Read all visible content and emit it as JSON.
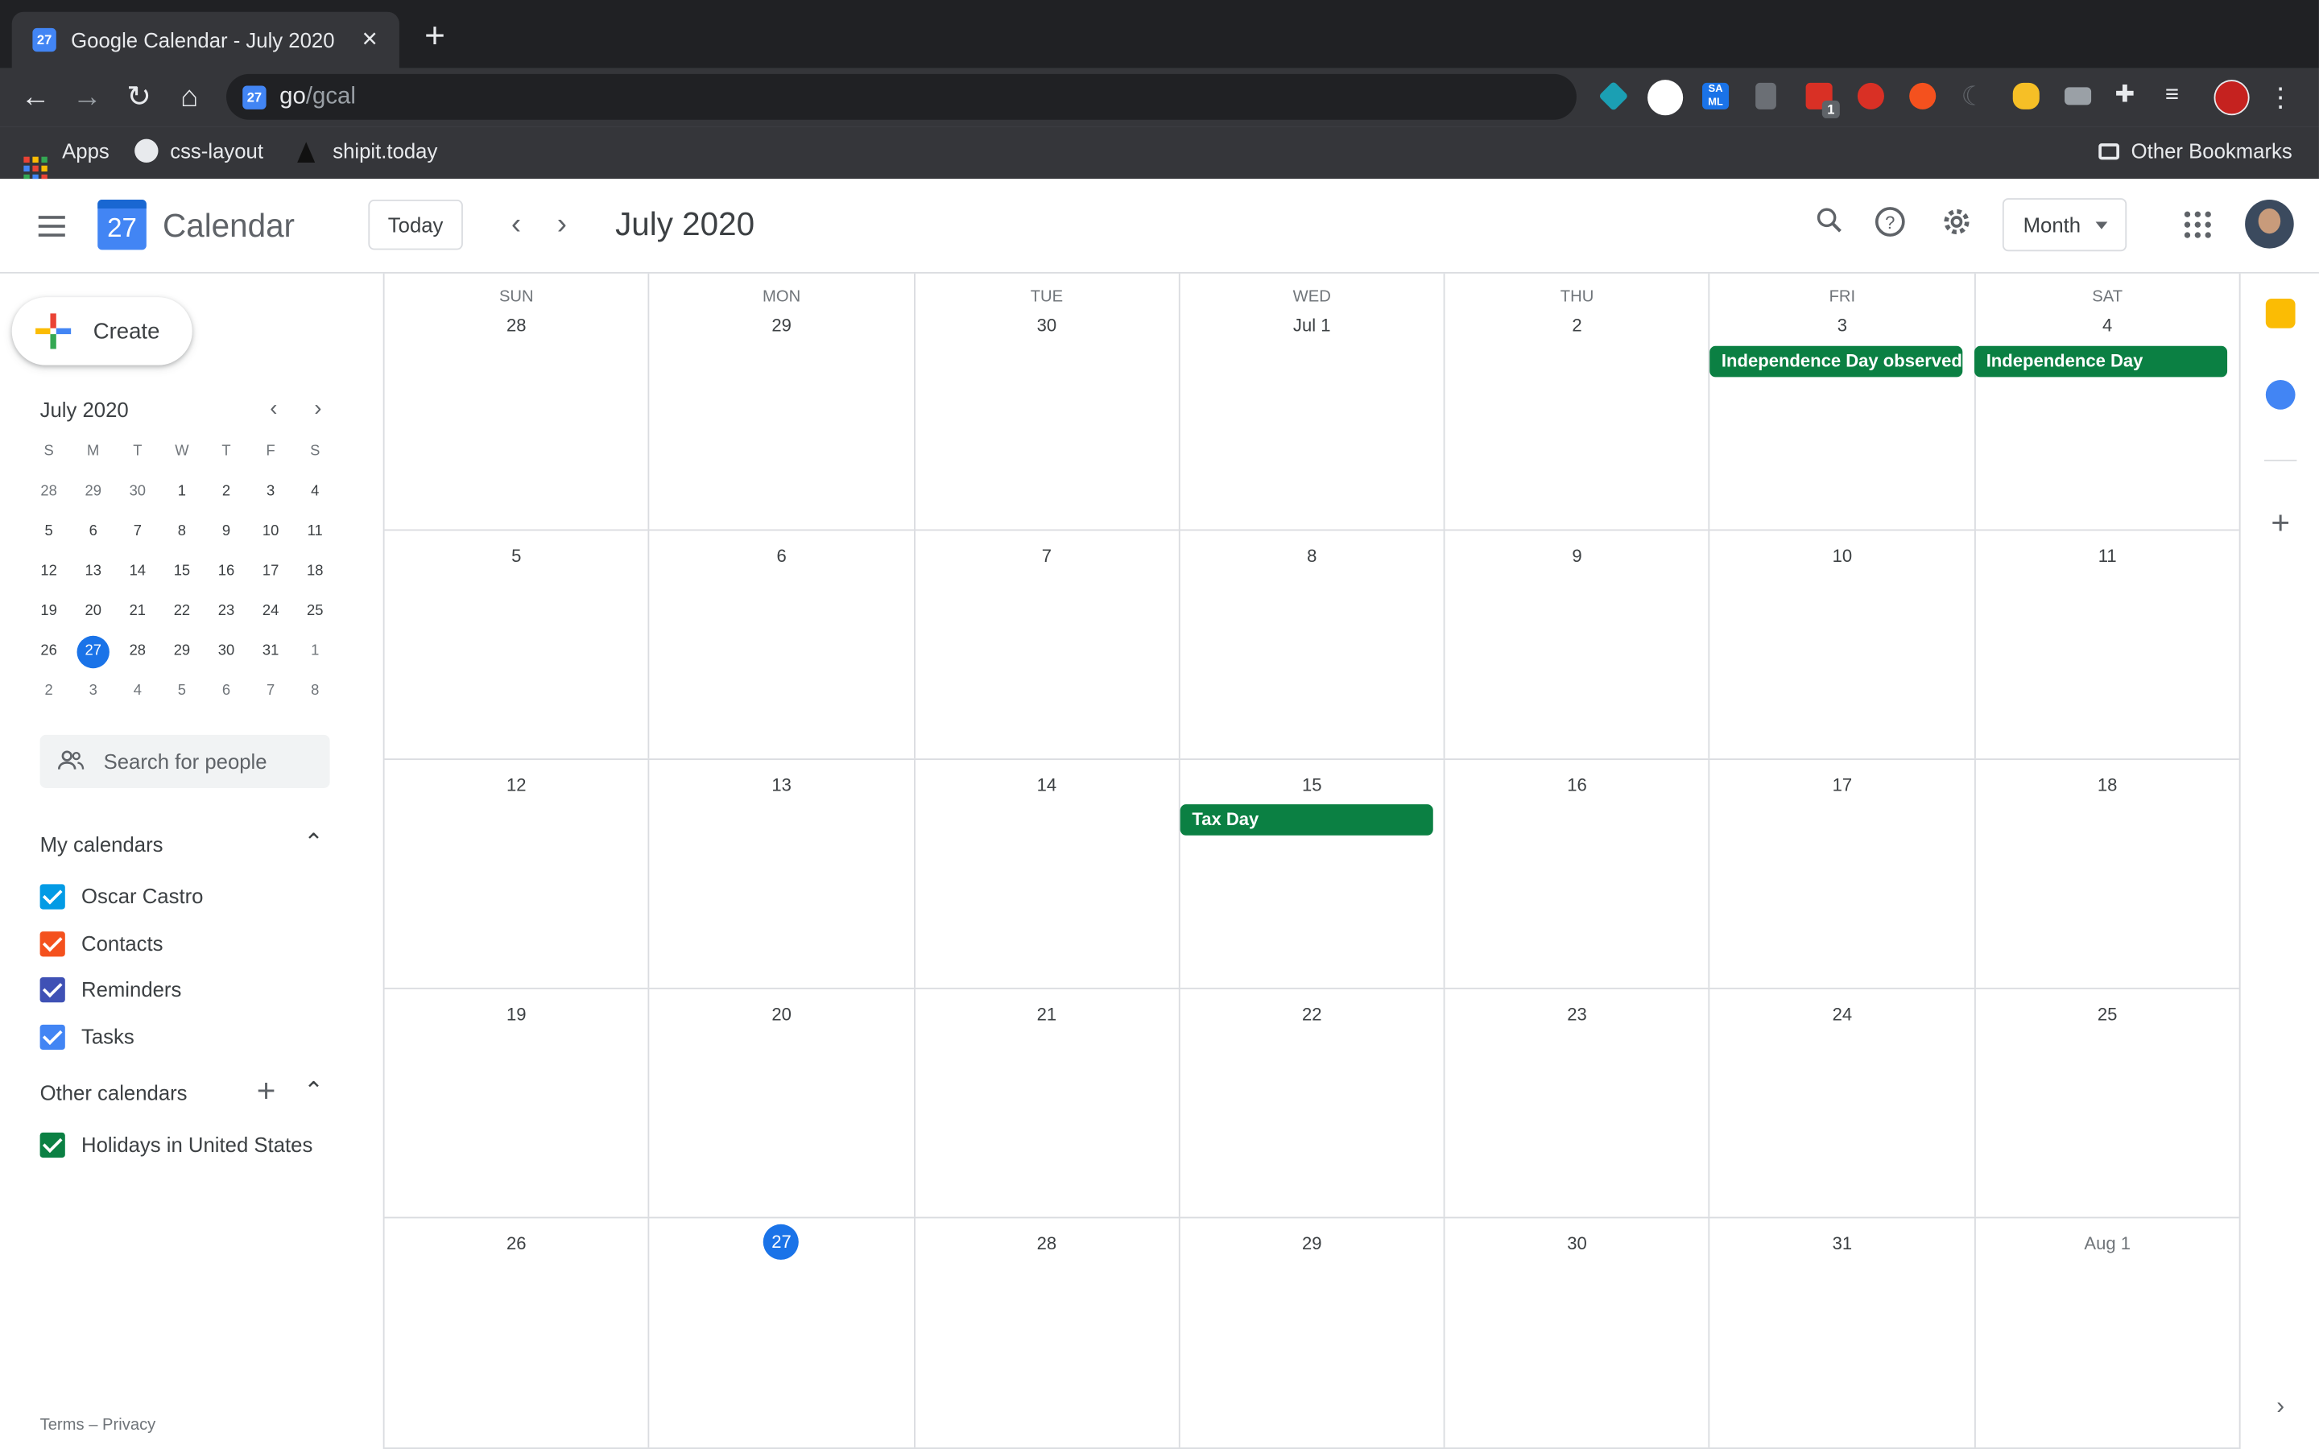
{
  "browser": {
    "tab_title": "Google Calendar - July 2020",
    "tab_favicon": "27",
    "url_host": "go",
    "url_path": "/gcal",
    "bookmarks": [
      "Apps",
      "css-layout",
      "shipit.today"
    ],
    "other_bookmarks": "Other Bookmarks",
    "extension_badge": "1",
    "extension_sa_ml": "SA ML"
  },
  "header": {
    "logo_day": "27",
    "app_name": "Calendar",
    "today_label": "Today",
    "title": "July 2020",
    "view_label": "Month"
  },
  "sidebar": {
    "create_label": "Create",
    "mini_title": "July 2020",
    "mini_weekdays": [
      "S",
      "M",
      "T",
      "W",
      "T",
      "F",
      "S"
    ],
    "mini_weeks": [
      [
        "28",
        "29",
        "30",
        "1",
        "2",
        "3",
        "4"
      ],
      [
        "5",
        "6",
        "7",
        "8",
        "9",
        "10",
        "11"
      ],
      [
        "12",
        "13",
        "14",
        "15",
        "16",
        "17",
        "18"
      ],
      [
        "19",
        "20",
        "21",
        "22",
        "23",
        "24",
        "25"
      ],
      [
        "26",
        "27",
        "28",
        "29",
        "30",
        "31",
        "1"
      ],
      [
        "2",
        "3",
        "4",
        "5",
        "6",
        "7",
        "8"
      ]
    ],
    "search_placeholder": "Search for people",
    "my_calendars_title": "My calendars",
    "my_calendars": [
      {
        "label": "Oscar Castro",
        "color": "#039be5"
      },
      {
        "label": "Contacts",
        "color": "#f4511e"
      },
      {
        "label": "Reminders",
        "color": "#3f51b5"
      },
      {
        "label": "Tasks",
        "color": "#4285f4"
      }
    ],
    "other_calendars_title": "Other calendars",
    "other_calendars": [
      {
        "label": "Holidays in United States",
        "color": "#0b8043"
      }
    ],
    "footer": "Terms – Privacy"
  },
  "grid": {
    "weekdays": [
      "SUN",
      "MON",
      "TUE",
      "WED",
      "THU",
      "FRI",
      "SAT"
    ],
    "weeks": [
      [
        "28",
        "29",
        "30",
        "Jul 1",
        "2",
        "3",
        "4"
      ],
      [
        "5",
        "6",
        "7",
        "8",
        "9",
        "10",
        "11"
      ],
      [
        "12",
        "13",
        "14",
        "15",
        "16",
        "17",
        "18"
      ],
      [
        "19",
        "20",
        "21",
        "22",
        "23",
        "24",
        "25"
      ],
      [
        "26",
        "27",
        "28",
        "29",
        "30",
        "31",
        "Aug 1"
      ]
    ],
    "events": {
      "independence_observed": "Independence Day observed",
      "independence_day": "Independence Day",
      "tax_day": "Tax Day"
    },
    "event_color": "#0b8043",
    "today_color": "#1a73e8"
  }
}
